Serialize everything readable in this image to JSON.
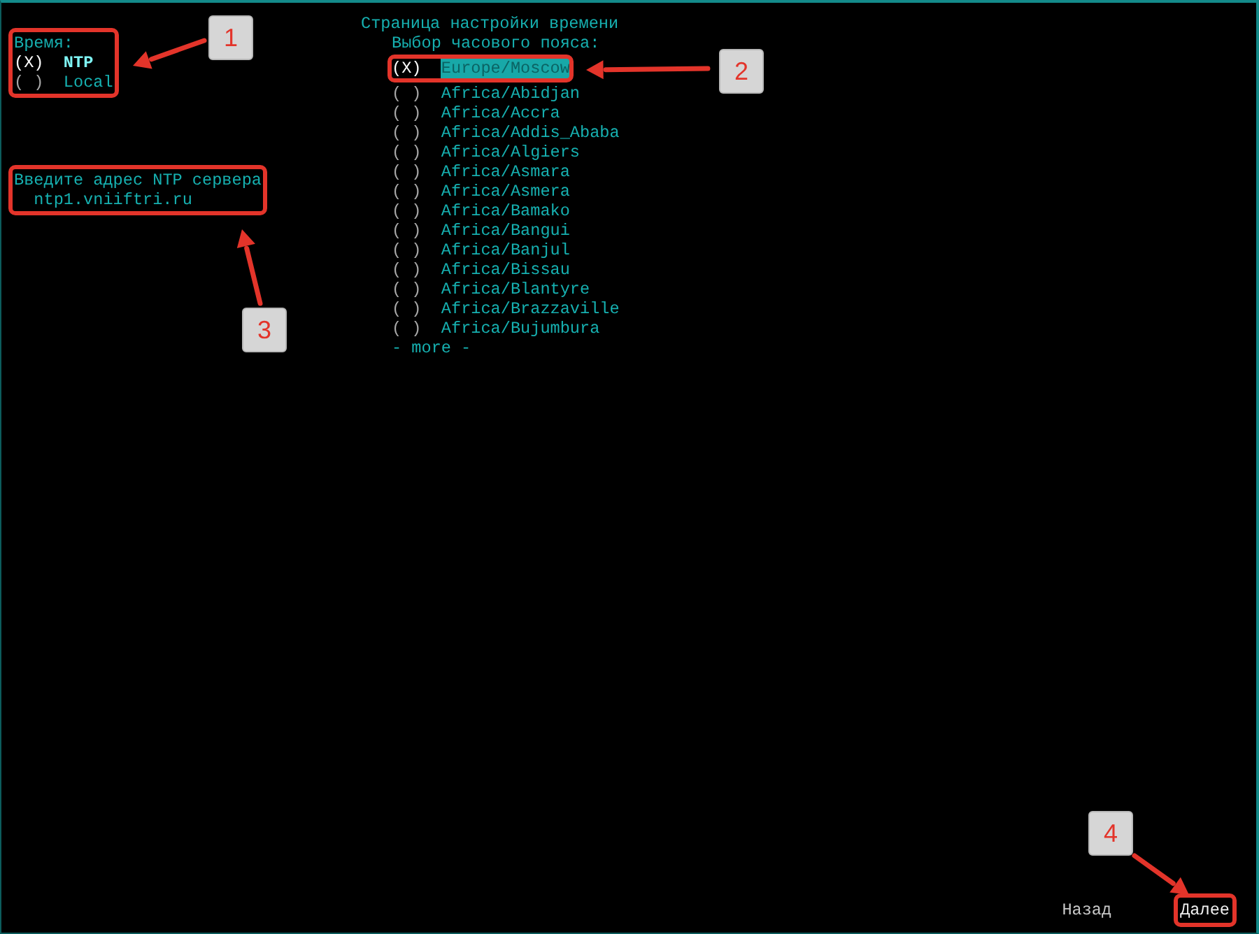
{
  "page_title": "Страница настройки времени",
  "time_mode": {
    "label": "Время:",
    "options": [
      {
        "marker": "(X)",
        "label": "NTP",
        "selected": true
      },
      {
        "marker": "( )",
        "label": "Local",
        "selected": false
      }
    ]
  },
  "ntp_server": {
    "label": "Введите адрес NTP сервера",
    "value": "ntp1.vniiftri.ru"
  },
  "timezone": {
    "label": "Выбор часового пояса:",
    "options": [
      {
        "marker": "(X)",
        "label": "Europe/Moscow",
        "selected": true
      },
      {
        "marker": "( )",
        "label": "Africa/Abidjan",
        "selected": false
      },
      {
        "marker": "( )",
        "label": "Africa/Accra",
        "selected": false
      },
      {
        "marker": "( )",
        "label": "Africa/Addis_Ababa",
        "selected": false
      },
      {
        "marker": "( )",
        "label": "Africa/Algiers",
        "selected": false
      },
      {
        "marker": "( )",
        "label": "Africa/Asmara",
        "selected": false
      },
      {
        "marker": "( )",
        "label": "Africa/Asmera",
        "selected": false
      },
      {
        "marker": "( )",
        "label": "Africa/Bamako",
        "selected": false
      },
      {
        "marker": "( )",
        "label": "Africa/Bangui",
        "selected": false
      },
      {
        "marker": "( )",
        "label": "Africa/Banjul",
        "selected": false
      },
      {
        "marker": "( )",
        "label": "Africa/Bissau",
        "selected": false
      },
      {
        "marker": "( )",
        "label": "Africa/Blantyre",
        "selected": false
      },
      {
        "marker": "( )",
        "label": "Africa/Brazzaville",
        "selected": false
      },
      {
        "marker": "( )",
        "label": "Africa/Bujumbura",
        "selected": false
      }
    ],
    "more": "- more -"
  },
  "buttons": [
    {
      "label": "Назад"
    },
    {
      "label": "Далее"
    }
  ],
  "annotations": [
    {
      "number": "1"
    },
    {
      "number": "2"
    },
    {
      "number": "3"
    },
    {
      "number": "4"
    }
  ]
}
